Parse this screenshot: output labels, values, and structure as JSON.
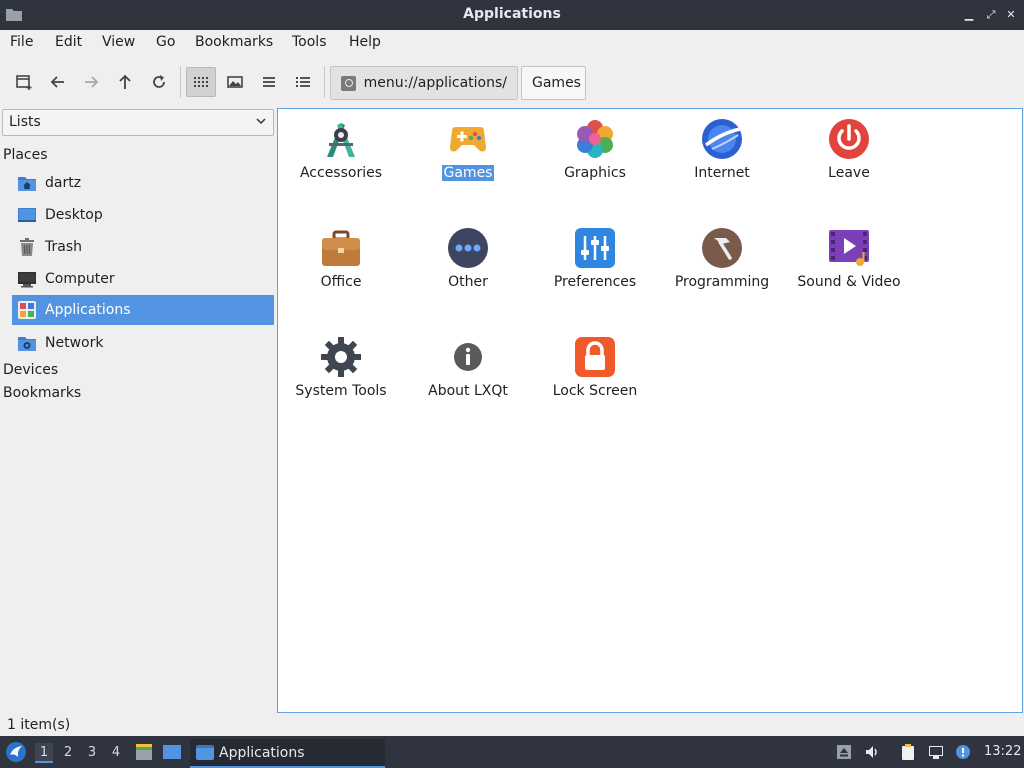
{
  "window": {
    "title": "Applications",
    "buttons": {
      "minimize": "▁",
      "maximize": "⤢",
      "close": "✕"
    }
  },
  "menubar": {
    "items": [
      "File",
      "Edit",
      "View",
      "Go",
      "Bookmarks",
      "Tools",
      "Help"
    ]
  },
  "toolbar": {
    "path_crumb": "menu://applications/",
    "current_crumb": "Games"
  },
  "sidepanel": {
    "view_selector": "Lists",
    "places_header": "Places",
    "places": [
      {
        "label": "dartz",
        "icon": "home-folder-icon"
      },
      {
        "label": "Desktop",
        "icon": "desktop-icon"
      },
      {
        "label": "Trash",
        "icon": "trash-icon"
      },
      {
        "label": "Computer",
        "icon": "computer-icon"
      },
      {
        "label": "Applications",
        "icon": "applications-icon",
        "selected": true
      },
      {
        "label": "Network",
        "icon": "network-icon"
      }
    ],
    "devices_header": "Devices",
    "bookmarks_header": "Bookmarks"
  },
  "main": {
    "items": [
      {
        "label": "Accessories",
        "icon": "accessories-icon"
      },
      {
        "label": "Games",
        "icon": "games-icon",
        "selected": true
      },
      {
        "label": "Graphics",
        "icon": "graphics-icon"
      },
      {
        "label": "Internet",
        "icon": "internet-icon"
      },
      {
        "label": "Leave",
        "icon": "leave-icon"
      },
      {
        "label": "Office",
        "icon": "office-icon"
      },
      {
        "label": "Other",
        "icon": "other-icon"
      },
      {
        "label": "Preferences",
        "icon": "preferences-icon"
      },
      {
        "label": "Programming",
        "icon": "programming-icon"
      },
      {
        "label": "Sound & Video",
        "icon": "sound-video-icon"
      },
      {
        "label": "System Tools",
        "icon": "system-tools-icon"
      },
      {
        "label": "About LXQt",
        "icon": "about-icon"
      },
      {
        "label": "Lock Screen",
        "icon": "lock-screen-icon"
      }
    ]
  },
  "statusbar": {
    "text": "1 item(s)"
  },
  "taskbar": {
    "workspaces": [
      "1",
      "2",
      "3",
      "4"
    ],
    "active_workspace": "1",
    "task_label": "Applications",
    "clock": "13:22"
  },
  "colors": {
    "accent": "#5294e2",
    "titlebar": "#2f343f",
    "background": "#efefef"
  }
}
